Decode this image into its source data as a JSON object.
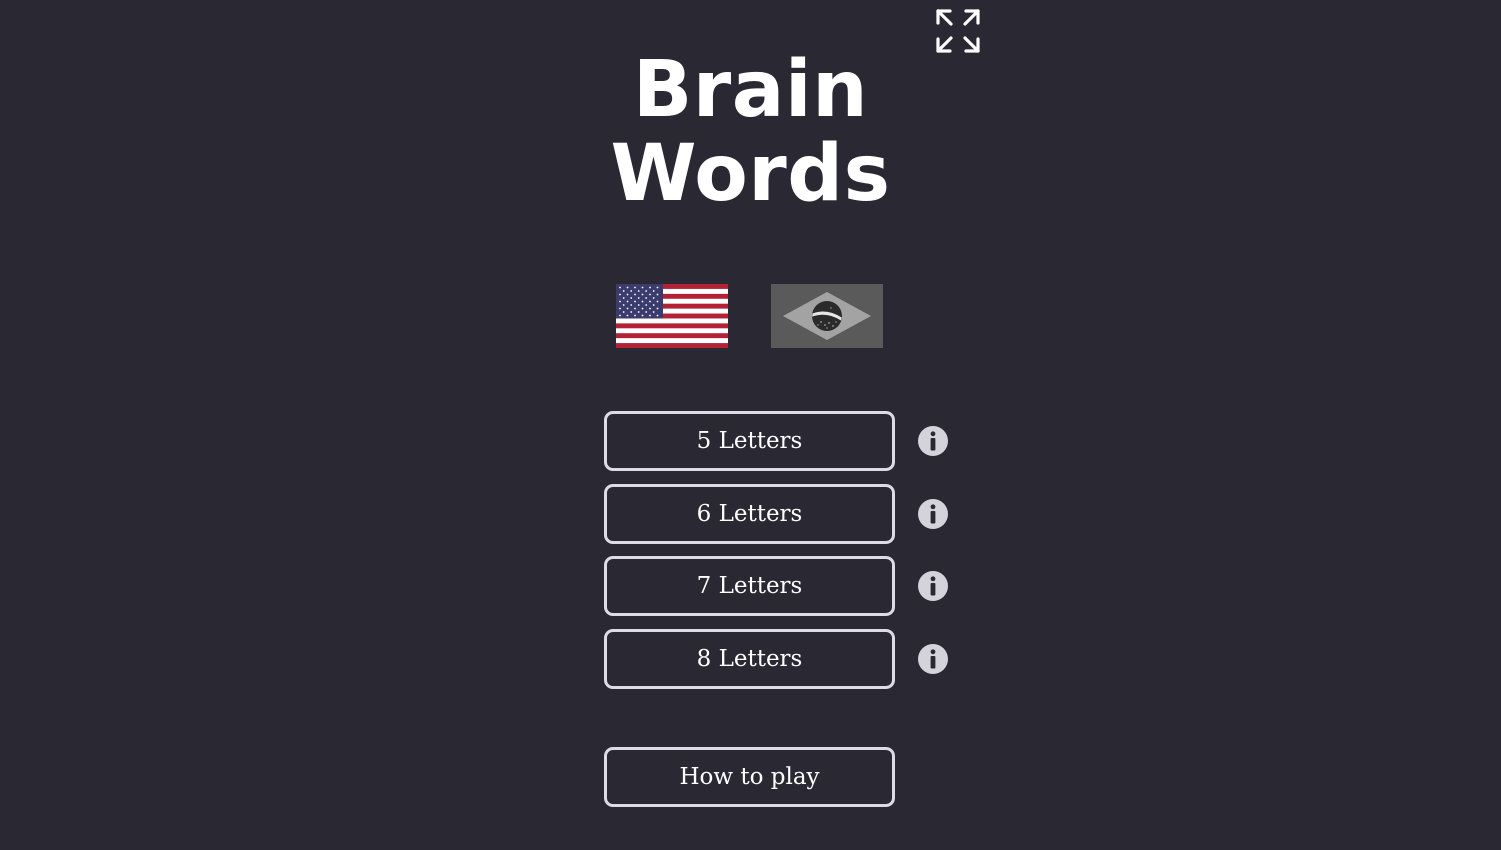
{
  "title": {
    "line1": "Brain",
    "line2": "Words"
  },
  "header": {
    "fullscreen_icon": "expand-arrows-icon"
  },
  "languages": [
    {
      "name": "English",
      "icon": "us-flag",
      "selected": true
    },
    {
      "name": "Português",
      "icon": "brazil-flag",
      "selected": false
    }
  ],
  "modes": [
    {
      "label": "5 Letters",
      "info_icon": "info-icon"
    },
    {
      "label": "6 Letters",
      "info_icon": "info-icon"
    },
    {
      "label": "7 Letters",
      "info_icon": "info-icon"
    },
    {
      "label": "8 Letters",
      "info_icon": "info-icon"
    }
  ],
  "how_to_play": {
    "label": "How to play"
  },
  "colors": {
    "background": "#2a2833",
    "button_border": "#dcdbe6",
    "text": "#ffffff",
    "info_icon": "#d4d3dc"
  }
}
